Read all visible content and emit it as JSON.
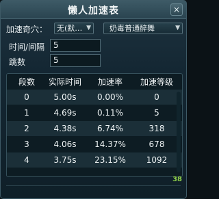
{
  "window": {
    "title": "懒人加速表",
    "close_label": "×"
  },
  "controls": {
    "acupoint_label": "加速奇穴：",
    "acupoint_value": "无(默…",
    "mode_value": "奶毒普通醉舞",
    "interval_label": "时间/间隔",
    "interval_value": "5",
    "jumps_label": "跳数",
    "jumps_value": "5"
  },
  "table": {
    "headers": [
      "段数",
      "实际时间",
      "加速率",
      "加速等级"
    ],
    "rows": [
      [
        "0",
        "5.00s",
        "0.00%",
        "0"
      ],
      [
        "1",
        "4.69s",
        "0.11%",
        "5"
      ],
      [
        "2",
        "4.38s",
        "6.74%",
        "318"
      ],
      [
        "3",
        "4.06s",
        "14.37%",
        "678"
      ],
      [
        "4",
        "3.75s",
        "23.15%",
        "1092"
      ]
    ]
  },
  "icons": {
    "dropdown": "chevron-down-icon",
    "close": "close-icon"
  },
  "badge_text": "38",
  "colors": {
    "title_bar": "#3d5a66",
    "panel_bg": "#0f1f28",
    "badge": "#8fd04a"
  }
}
